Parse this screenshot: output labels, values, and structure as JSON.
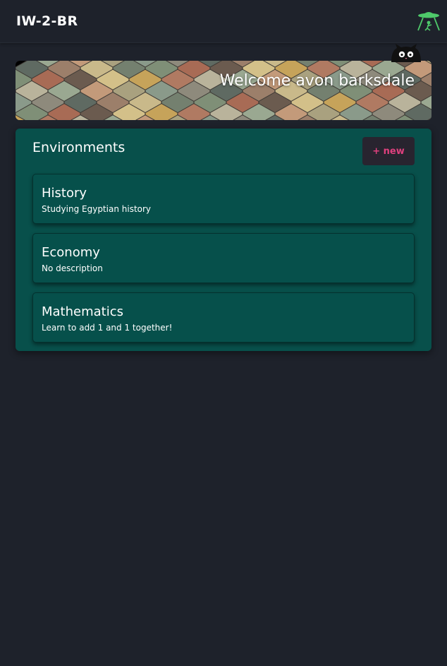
{
  "header": {
    "title": "IW-2-BR",
    "logo_icon": "ufo-icon",
    "logo_color": "#4ec96a"
  },
  "banner": {
    "welcome": "Welcome avon barksdale",
    "background": "colorful-shingle-tiles",
    "mascot_icon": "cat-peek-icon"
  },
  "environments": {
    "heading": "Environments",
    "new_button_label": "+ new",
    "panel_color": "#08504b",
    "accent_color": "#e0407e",
    "items": [
      {
        "name": "History",
        "description": "Studying Egyptian history"
      },
      {
        "name": "Economy",
        "description": "No description"
      },
      {
        "name": "Mathematics",
        "description": "Learn to add 1 and 1 together!"
      }
    ]
  }
}
